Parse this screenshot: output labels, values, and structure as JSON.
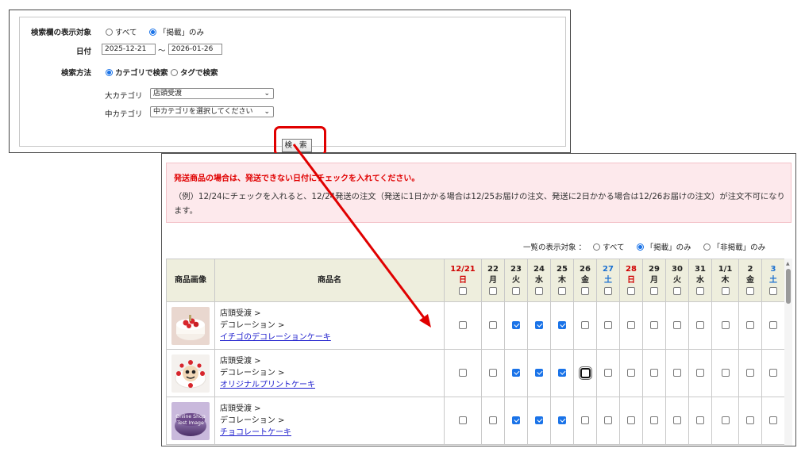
{
  "search": {
    "display_target_label": "検索欄の表示対象",
    "display_all": "すべて",
    "display_listed": "「掲載」のみ",
    "date_label": "日付",
    "date_from": "2025-12-21",
    "date_sep": "～",
    "date_to": "2026-01-26",
    "method_label": "検索方法",
    "method_category": "カテゴリで検索",
    "method_tag": "タグで検索",
    "major_category_label": "大カテゴリ",
    "major_category_value": "店頭受渡",
    "middle_category_label": "中カテゴリ",
    "middle_category_value": "中カテゴリを選択してください",
    "search_button": "検 索"
  },
  "notice": {
    "warning": "発送商品の場合は、発送できない日付にチェックを入れてください。",
    "example": "（例）12/24にチェックを入れると、12/24発送の注文（発送に1日かかる場合は12/25お届けの注文、発送に2日かかる場合は12/26お届けの注文）が注文不可になります。"
  },
  "list_display": {
    "label": "一覧の表示対象 ：",
    "all": "すべて",
    "listed": "「掲載」のみ",
    "unlisted": "「非掲載」のみ"
  },
  "table": {
    "col_image": "商品画像",
    "col_name": "商品名",
    "dates": [
      {
        "d": "12/21",
        "w": "日",
        "type": "sun"
      },
      {
        "d": "22",
        "w": "月",
        "type": "wd"
      },
      {
        "d": "23",
        "w": "火",
        "type": "wd"
      },
      {
        "d": "24",
        "w": "水",
        "type": "wd"
      },
      {
        "d": "25",
        "w": "木",
        "type": "wd"
      },
      {
        "d": "26",
        "w": "金",
        "type": "wd"
      },
      {
        "d": "27",
        "w": "土",
        "type": "sat"
      },
      {
        "d": "28",
        "w": "日",
        "type": "sun"
      },
      {
        "d": "29",
        "w": "月",
        "type": "wd"
      },
      {
        "d": "30",
        "w": "火",
        "type": "wd"
      },
      {
        "d": "31",
        "w": "水",
        "type": "wd"
      },
      {
        "d": "1/1",
        "w": "木",
        "type": "wd"
      },
      {
        "d": "2",
        "w": "金",
        "type": "wd"
      },
      {
        "d": "3",
        "w": "土",
        "type": "sat"
      }
    ],
    "rows": [
      {
        "path1": "店頭受渡 >",
        "path2": "デコレーション >",
        "name": "イチゴのデコレーションケーキ",
        "image": "strawberry-cake-icon",
        "checked": [
          2,
          3,
          4
        ],
        "focus": -1
      },
      {
        "path1": "店頭受渡 >",
        "path2": "デコレーション >",
        "name": "オリジナルプリントケーキ",
        "image": "print-cake-icon",
        "checked": [
          2,
          3,
          4
        ],
        "focus": 5
      },
      {
        "path1": "店頭受渡 >",
        "path2": "デコレーション >",
        "name": "チョコレートケーキ",
        "image": "chocolate-cake-icon",
        "image_text": "Online Shop Test Image",
        "checked": [
          2,
          3,
          4
        ],
        "focus": -1
      }
    ]
  },
  "colors": {
    "accent": "#1a73e8",
    "warning_red": "#e00000",
    "highlight": "#e00000",
    "notice_bg": "#fde9ec",
    "header_bg": "#eeeedd"
  }
}
